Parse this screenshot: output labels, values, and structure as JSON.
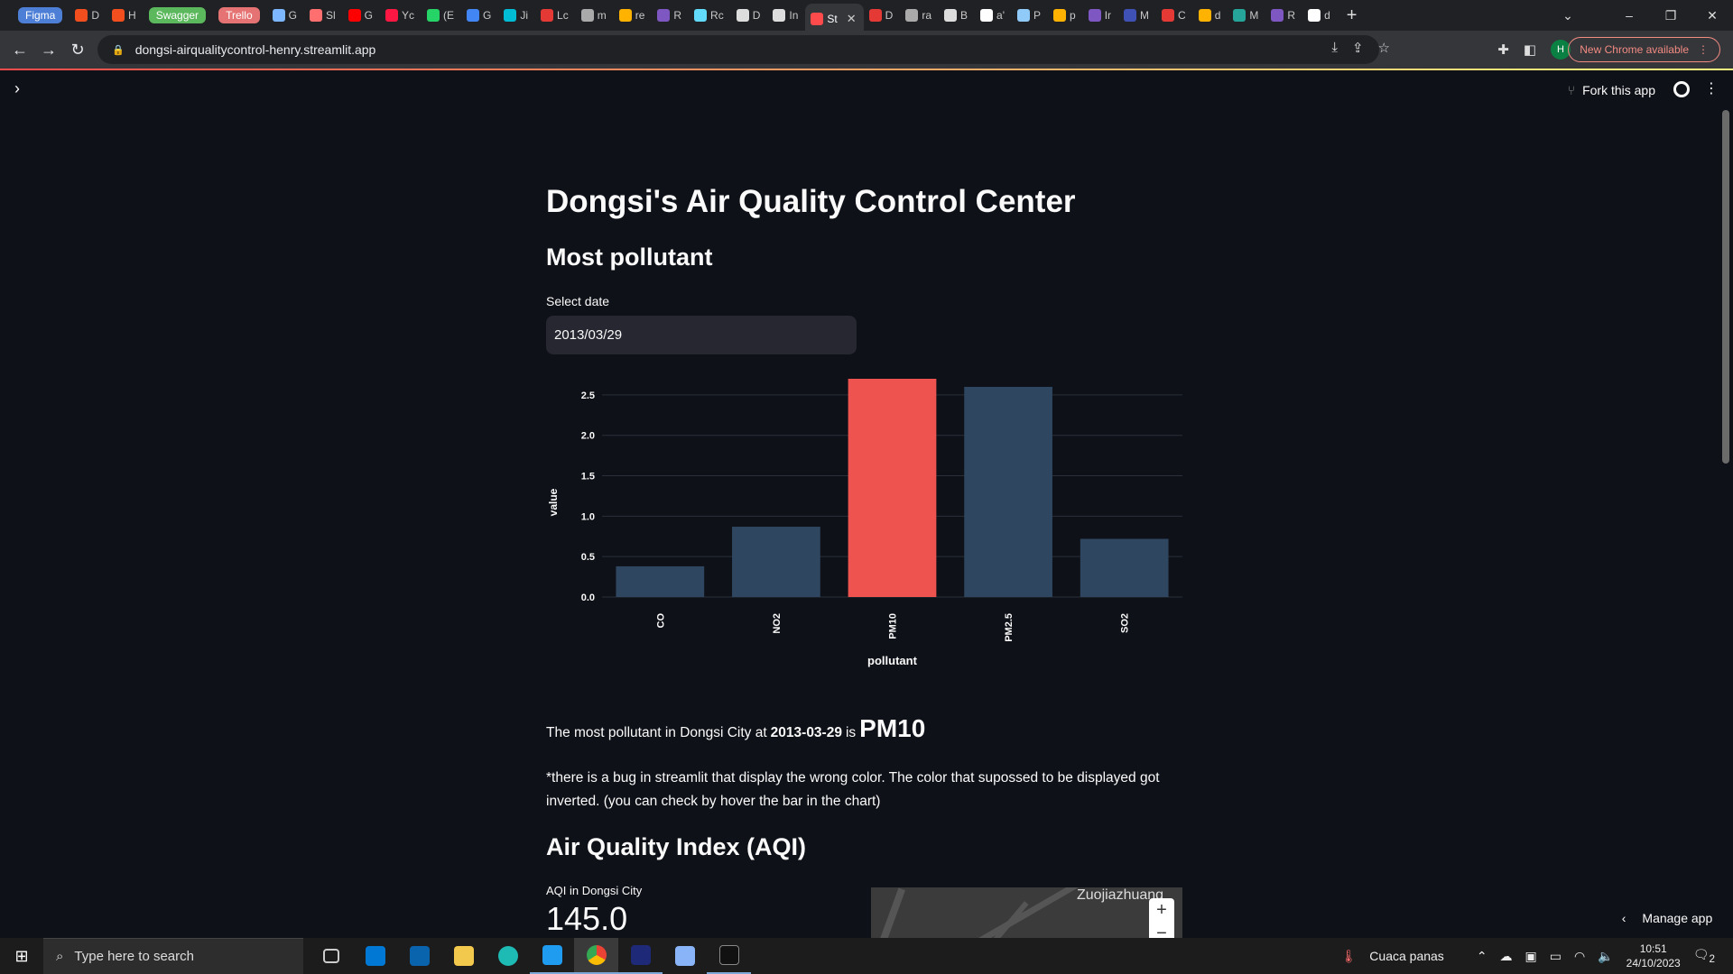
{
  "browser": {
    "tabs": [
      {
        "label": "Figma",
        "kind": "pill",
        "color": "#4d7fd6"
      },
      {
        "label": "D",
        "color": "#f24e1e"
      },
      {
        "label": "H",
        "color": "#f24e1e"
      },
      {
        "label": "Swagger",
        "kind": "pill",
        "color": "#5cb85c"
      },
      {
        "label": "Trello",
        "kind": "pill",
        "color": "#e57373"
      },
      {
        "label": "G",
        "color": "#7cb7ff"
      },
      {
        "label": "Sl",
        "color": "#ff6f6f"
      },
      {
        "label": "G",
        "color": "#ff0000"
      },
      {
        "label": "Yc",
        "color": "#ff1744"
      },
      {
        "label": "(E",
        "color": "#25d366"
      },
      {
        "label": "G",
        "color": "#4285f4"
      },
      {
        "label": "Ji",
        "color": "#00bcd4"
      },
      {
        "label": "Lc",
        "color": "#e53935"
      },
      {
        "label": "m",
        "color": "#aaaaaa"
      },
      {
        "label": "re",
        "color": "#ffb300"
      },
      {
        "label": "R",
        "color": "#7e57c2"
      },
      {
        "label": "Rc",
        "color": "#61dafb"
      },
      {
        "label": "D",
        "color": "#dddddd"
      },
      {
        "label": "In",
        "color": "#dddddd"
      },
      {
        "label": "St",
        "active": true,
        "color": "#ff4b4b"
      },
      {
        "label": "D",
        "color": "#e53935"
      },
      {
        "label": "ra",
        "color": "#aaaaaa"
      },
      {
        "label": "B",
        "color": "#dddddd"
      },
      {
        "label": "a'",
        "color": "#ffffff"
      },
      {
        "label": "P",
        "color": "#90caf9"
      },
      {
        "label": "p",
        "color": "#ffb300"
      },
      {
        "label": "Ir",
        "color": "#7e57c2"
      },
      {
        "label": "M",
        "color": "#3f51b5"
      },
      {
        "label": "C",
        "color": "#e53935"
      },
      {
        "label": "d",
        "color": "#ffb300"
      },
      {
        "label": "M",
        "color": "#26a69a"
      },
      {
        "label": "R",
        "color": "#7e57c2"
      },
      {
        "label": "d",
        "color": "#ffffff"
      }
    ],
    "new_tab": "+",
    "url": "dongsi-airqualitycontrol-henry.streamlit.app",
    "profile_initial": "H",
    "update_label": "New Chrome available"
  },
  "header": {
    "fork_label": "Fork this app"
  },
  "page": {
    "title": "Dongsi's Air Quality Control Center",
    "section1": "Most pollutant",
    "date_label": "Select date",
    "date_value": "2013/03/29",
    "result_prefix": "The most pollutant in Dongsi City at",
    "result_date": "2013-03-29",
    "result_is": "is",
    "result_pollutant": "PM10",
    "note": "*there is a bug in streamlit that display the wrong color. The color that supossed to be displayed got inverted. (you can check by hover the bar in the chart)",
    "section2": "Air Quality Index (AQI)",
    "aqi_label": "AQI in Dongsi City",
    "aqi_value": "145.0",
    "map_place": "Zuojiazhuang",
    "manage_label": "Manage app"
  },
  "chart_data": {
    "type": "bar",
    "categories": [
      "CO",
      "NO2",
      "PM10",
      "PM2.5",
      "SO2"
    ],
    "values": [
      0.38,
      0.87,
      2.7,
      2.6,
      0.72
    ],
    "highlight": "PM10",
    "colors": {
      "default": "#2e4660",
      "highlight": "#ef5350",
      "grid": "#2a2f3a",
      "text": "#fafafa"
    },
    "xlabel": "pollutant",
    "ylabel": "value",
    "ylim": [
      0,
      2.7
    ],
    "yticks": [
      "0.0",
      "0.5",
      "1.0",
      "1.5",
      "2.0",
      "2.5"
    ],
    "grid": true
  },
  "taskbar": {
    "search_placeholder": "Type here to search",
    "weather": "Cuaca panas",
    "time": "10:51",
    "date": "24/10/2023",
    "notifications": "2"
  }
}
